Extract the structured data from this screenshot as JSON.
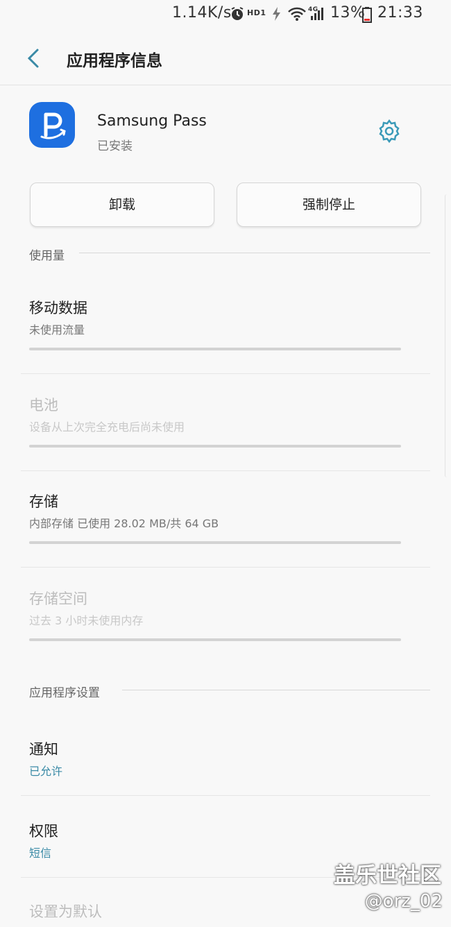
{
  "status_bar": {
    "speed": "1.14K/s",
    "hd": "HD1",
    "network": "4G",
    "battery": "13%",
    "time": "21:33",
    "icons": [
      "alarm-icon",
      "hd-icon",
      "charging-bolt-icon",
      "wifi-icon",
      "signal-icon",
      "battery-icon"
    ]
  },
  "header": {
    "title": "应用程序信息",
    "back_icon": "chevron-left-icon"
  },
  "app": {
    "name": "Samsung Pass",
    "status": "已安装",
    "icon_color": "#1e6fe0",
    "settings_icon": "gear-icon",
    "accent": "#3a9ab8"
  },
  "buttons": {
    "uninstall": "卸载",
    "force_stop": "强制停止"
  },
  "usage": {
    "heading": "使用量",
    "items": [
      {
        "title": "移动数据",
        "subtitle": "未使用流量"
      },
      {
        "title": "电池",
        "subtitle": "设备从上次完全充电后尚未使用"
      },
      {
        "title": "存储",
        "subtitle": "内部存储 已使用 28.02 MB/共 64 GB"
      },
      {
        "title": "存储空间",
        "subtitle": "过去 3 小时未使用内存"
      }
    ]
  },
  "app_settings": {
    "heading": "应用程序设置",
    "items": [
      {
        "title": "通知",
        "subtitle": "已允许"
      },
      {
        "title": "权限",
        "subtitle": "短信"
      },
      {
        "title": "设置为默认"
      }
    ]
  },
  "watermark": {
    "site": "盖乐世社区",
    "user": "@orz_02"
  }
}
